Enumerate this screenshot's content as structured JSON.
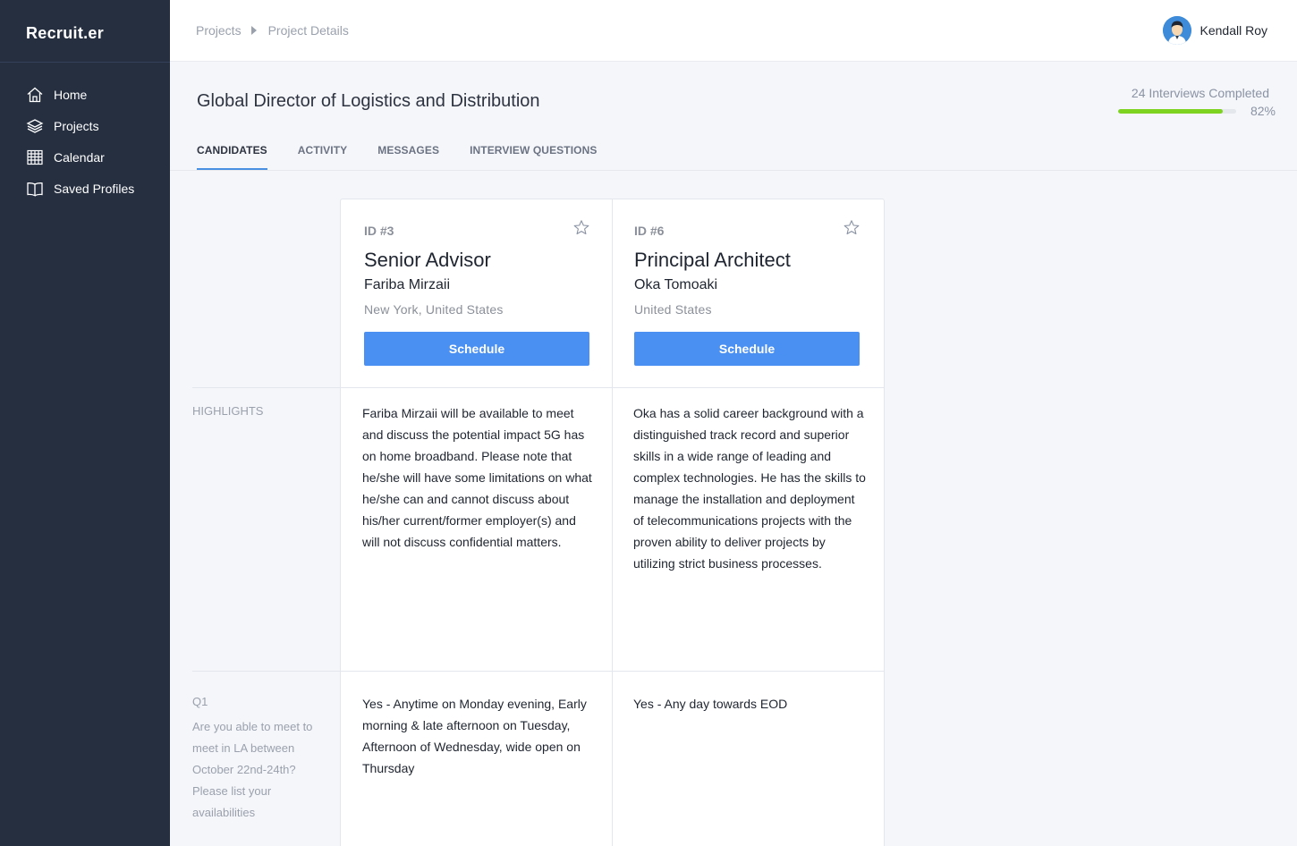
{
  "app": {
    "brand": "Recruit.er"
  },
  "sidebar": {
    "items": [
      {
        "label": "Home",
        "icon": "home-icon"
      },
      {
        "label": "Projects",
        "icon": "layers-icon"
      },
      {
        "label": "Calendar",
        "icon": "calendar-icon"
      },
      {
        "label": "Saved Profiles",
        "icon": "book-icon"
      }
    ]
  },
  "header": {
    "breadcrumb": [
      "Projects",
      "Project Details"
    ],
    "user": {
      "name": "Kendall Roy"
    }
  },
  "project": {
    "title": "Global Director of Logistics and Distribution",
    "progress": {
      "label": "24 Interviews Completed",
      "percent_text": "82%",
      "fraction": 0.89
    }
  },
  "tabs": [
    {
      "label": "CANDIDATES",
      "active": true
    },
    {
      "label": "ACTIVITY",
      "active": false
    },
    {
      "label": "MESSAGES",
      "active": false
    },
    {
      "label": "INTERVIEW QUESTIONS",
      "active": false
    }
  ],
  "rows": {
    "highlights_label": "HIGHLIGHTS",
    "q1_label": "Q1",
    "q1_question": "Are you able to meet to meet in LA between October 22nd-24th? Please list your availabilities"
  },
  "candidates": [
    {
      "id": "ID #3",
      "role": "Senior Advisor",
      "name": "Fariba Mirzaii",
      "location": "New York, United States",
      "button": "Schedule",
      "highlights": "Fariba Mirzaii will be available to meet and discuss the potential impact 5G has on home broadband. Please note that he/she will have some limitations on what he/she can and cannot discuss about his/her current/former employer(s) and will not discuss confidential matters.",
      "q1_answer": "Yes - Anytime on Monday evening, Early morning & late afternoon on Tuesday, Afternoon of Wednesday, wide open on Thursday"
    },
    {
      "id": "ID #6",
      "role": "Principal Architect",
      "name": "Oka Tomoaki",
      "location": "United States",
      "button": "Schedule",
      "highlights": "Oka has a solid career background with a distinguished track record and superior skills in a wide range of leading and complex technologies. He has the skills to manage the installation and deployment of telecommunications projects with the proven ability to deliver projects by utilizing strict business processes.",
      "q1_answer": "Yes - Any day towards EOD"
    }
  ],
  "colors": {
    "sidebar": "#252f40",
    "accent": "#4a90e2",
    "button": "#4a90f2",
    "progress": "#7ed321"
  }
}
